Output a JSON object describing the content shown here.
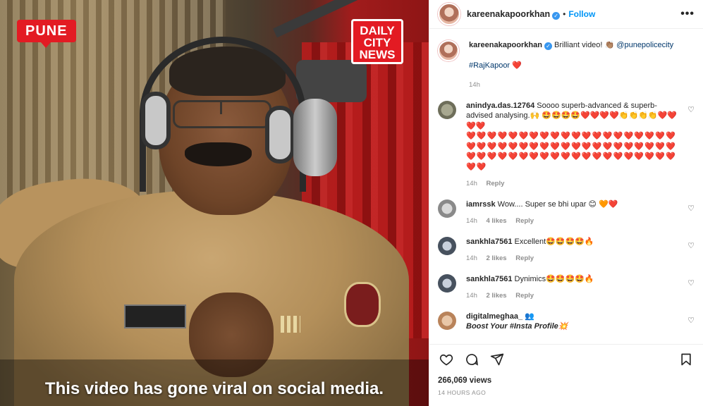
{
  "video": {
    "location_tag": "PUNE",
    "brand_logo": [
      "DAILY",
      "CITY",
      "NEWS"
    ],
    "caption": "This video has gone viral on social media."
  },
  "header": {
    "username": "kareenakapoorkhan",
    "dot": "•",
    "follow_label": "Follow",
    "more_label": "•••"
  },
  "caption_post": {
    "username": "kareenakapoorkhan",
    "text": "Brilliant video! 👏🏽",
    "mention": "@punepolicecity",
    "hashtag": "#RajKapoor",
    "hashtag_emoji": "❤️",
    "time": "14h"
  },
  "comments": [
    {
      "username": "anindya.das.12764",
      "text": "Soooo superb-advanced & superb-advised analysing.🙌 🤩🤩🤩🤩❤️❤️❤️❤️👏👏👏👏❤️❤️❤️❤️",
      "hearts": "❤️❤️❤️❤️❤️❤️❤️❤️❤️❤️❤️❤️❤️❤️❤️❤️❤️❤️❤️❤️❤️❤️❤️❤️❤️❤️❤️❤️❤️❤️❤️❤️❤️❤️❤️❤️❤️❤️❤️❤️❤️❤️❤️❤️❤️❤️❤️❤️❤️❤️❤️❤️❤️❤️❤️❤️❤️❤️❤️❤️❤️❤️",
      "time": "14h",
      "likes": "",
      "reply": "Reply"
    },
    {
      "username": "iamrssk",
      "text": "Wow.... Super se bhi upar 😊 🧡❤️",
      "hearts": "",
      "time": "14h",
      "likes": "4 likes",
      "reply": "Reply"
    },
    {
      "username": "sankhla7561",
      "text": "Excellent🤩🤩🤩🤩🔥",
      "hearts": "",
      "time": "14h",
      "likes": "2 likes",
      "reply": "Reply"
    },
    {
      "username": "sankhla7561",
      "text": "Dynimics🤩🤩🤩🤩🔥",
      "hearts": "",
      "time": "14h",
      "likes": "2 likes",
      "reply": "Reply"
    },
    {
      "username": "digitalmeghaa_",
      "text": "👥",
      "line2": "Boost Your #Insta Profile💥",
      "hearts": "",
      "time": "",
      "likes": "",
      "reply": ""
    }
  ],
  "stats": {
    "views": "266,069 views",
    "posted": "14 HOURS AGO"
  },
  "colors": {
    "accent": "#0095f6",
    "brand_red": "#e31b23",
    "heart_red": "#e0102e"
  },
  "icons": [
    "heart-icon",
    "comment-icon",
    "share-icon",
    "save-icon",
    "verified-icon",
    "more-icon"
  ]
}
